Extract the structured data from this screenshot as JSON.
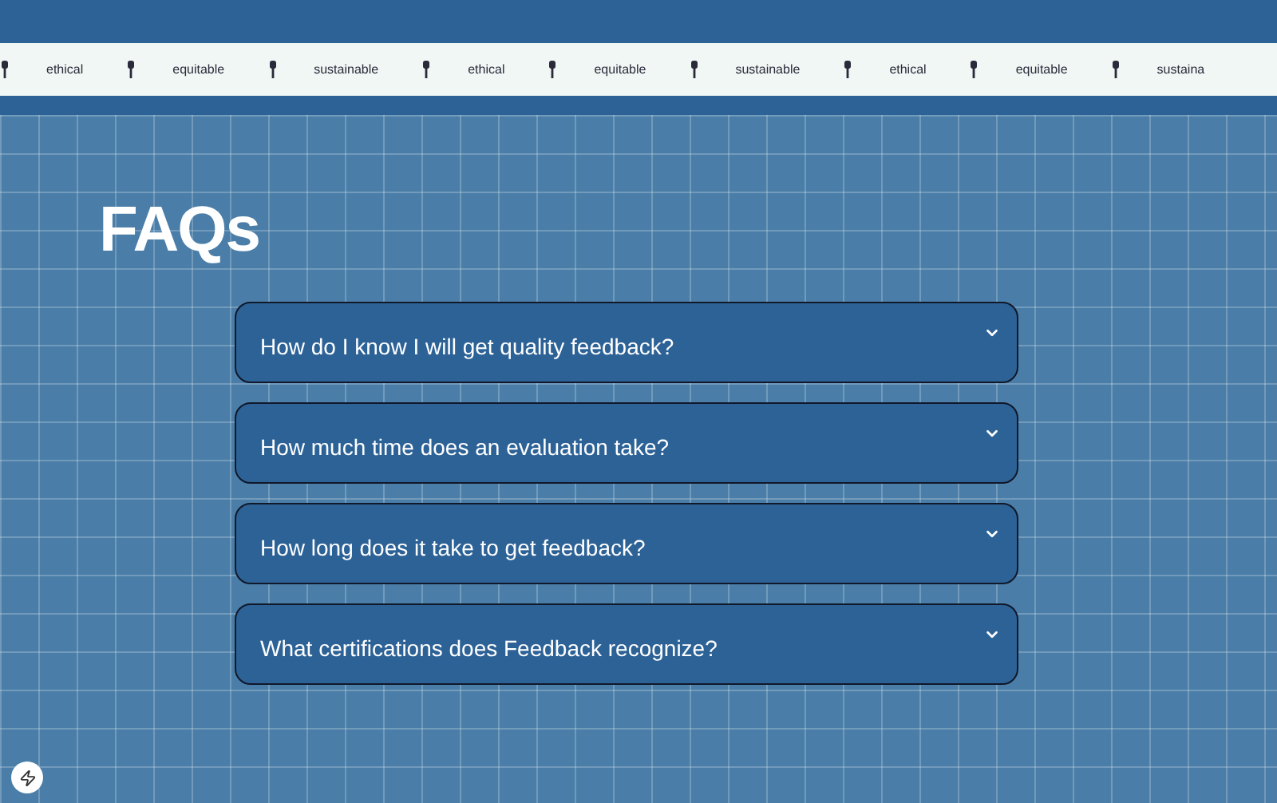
{
  "marquee": [
    {
      "label": "ethical"
    },
    {
      "label": "equitable"
    },
    {
      "label": "sustainable"
    },
    {
      "label": "ethical"
    },
    {
      "label": "equitable"
    },
    {
      "label": "sustainable"
    },
    {
      "label": "ethical"
    },
    {
      "label": "equitable"
    },
    {
      "label": "sustaina"
    }
  ],
  "title": "FAQs",
  "faqs": [
    {
      "question": "How do I know I will get quality feedback?",
      "expanded": false
    },
    {
      "question": "How much time does an evaluation take?",
      "expanded": false
    },
    {
      "question": "How long does it take to get feedback?",
      "expanded": false
    },
    {
      "question": "What certifications does Feedback recognize?",
      "expanded": false
    }
  ]
}
